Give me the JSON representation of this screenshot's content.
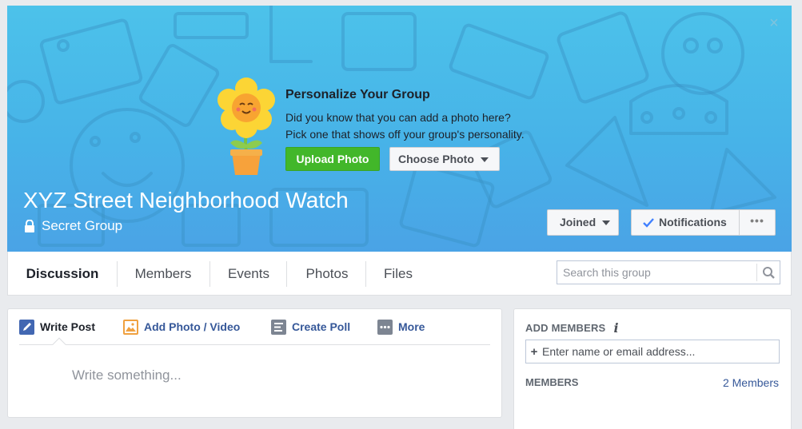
{
  "cover": {
    "promo_title": "Personalize Your Group",
    "promo_line1": "Did you know that you can add a photo here?",
    "promo_line2": "Pick one that shows off your group's personality.",
    "upload_label": "Upload Photo",
    "choose_label": "Choose Photo",
    "close_glyph": "×"
  },
  "group": {
    "name": "XYZ Street Neighborhood Watch",
    "privacy": "Secret Group"
  },
  "actions": {
    "joined_label": "Joined",
    "notifications_label": "Notifications",
    "more_label": "•••"
  },
  "tabs": [
    {
      "label": "Discussion",
      "active": true
    },
    {
      "label": "Members"
    },
    {
      "label": "Events"
    },
    {
      "label": "Photos"
    },
    {
      "label": "Files"
    }
  ],
  "search": {
    "placeholder": "Search this group"
  },
  "composer": {
    "tabs": [
      {
        "label": "Write Post",
        "icon": "pencil-icon"
      },
      {
        "label": "Add Photo / Video",
        "icon": "photo-icon"
      },
      {
        "label": "Create Poll",
        "icon": "poll-icon"
      },
      {
        "label": "More",
        "icon": "more-icon"
      }
    ],
    "placeholder": "Write something..."
  },
  "sidebar": {
    "add_members_heading": "ADD MEMBERS",
    "add_members_placeholder": "Enter name or email address...",
    "members_heading": "MEMBERS",
    "members_count": "2 Members"
  },
  "colors": {
    "cover_top": "#4cc2ea",
    "cover_bottom": "#4aa3e6",
    "upload_green": "#42b72a",
    "link_blue": "#365899"
  }
}
